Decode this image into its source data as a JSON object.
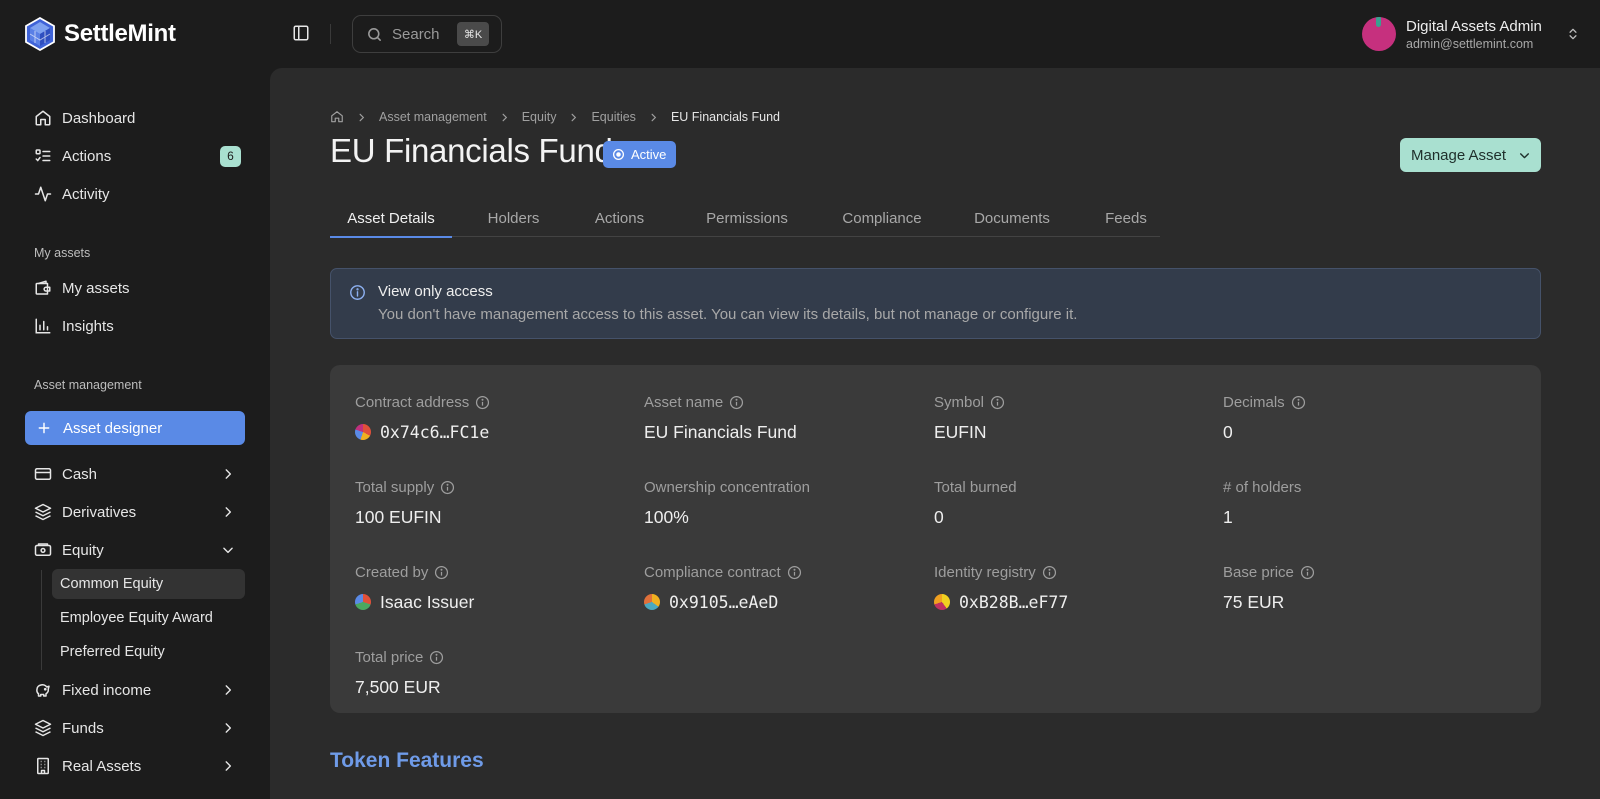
{
  "brand": {
    "name": "SettleMint"
  },
  "topbar": {
    "search_placeholder": "Search",
    "search_shortcut": "⌘K"
  },
  "user": {
    "name": "Digital Assets Admin",
    "email": "admin@settlemint.com"
  },
  "sidebar": {
    "main_items": [
      {
        "label": "Dashboard",
        "icon": "home-icon"
      },
      {
        "label": "Actions",
        "icon": "checklist-icon",
        "badge": "6"
      },
      {
        "label": "Activity",
        "icon": "activity-icon"
      }
    ],
    "my_assets_label": "My assets",
    "my_assets_items": [
      {
        "label": "My assets",
        "icon": "wallet-icon"
      },
      {
        "label": "Insights",
        "icon": "bar-chart-icon"
      }
    ],
    "asset_management_label": "Asset management",
    "asset_designer_label": "Asset designer",
    "asset_items": [
      {
        "label": "Cash",
        "icon": "banknote-icon"
      },
      {
        "label": "Derivatives",
        "icon": "layers-icon"
      },
      {
        "label": "Equity",
        "icon": "equity-icon",
        "expanded": true
      },
      {
        "label": "Fixed income",
        "icon": "piggy-bank-icon"
      },
      {
        "label": "Funds",
        "icon": "layers-icon"
      },
      {
        "label": "Real Assets",
        "icon": "building-icon"
      }
    ],
    "equity_subitems": [
      {
        "label": "Common Equity",
        "active": true
      },
      {
        "label": "Employee Equity Award"
      },
      {
        "label": "Preferred Equity"
      }
    ]
  },
  "breadcrumb": [
    "Asset management",
    "Equity",
    "Equities",
    "EU Financials Fund"
  ],
  "page": {
    "title": "EU Financials Fund",
    "status": "Active",
    "manage_button": "Manage Asset"
  },
  "tabs": [
    "Asset Details",
    "Holders",
    "Actions",
    "Permissions",
    "Compliance",
    "Documents",
    "Feeds"
  ],
  "alert": {
    "title": "View only access",
    "description": "You don't have management access to this asset. You can view its details, but not manage or configure it."
  },
  "details": {
    "contract_address": {
      "label": "Contract address",
      "value": "0x74c6…FC1e"
    },
    "asset_name": {
      "label": "Asset name",
      "value": "EU Financials Fund"
    },
    "symbol": {
      "label": "Symbol",
      "value": "EUFIN"
    },
    "decimals": {
      "label": "Decimals",
      "value": "0"
    },
    "total_supply": {
      "label": "Total supply",
      "value": "100 EUFIN"
    },
    "ownership_concentration": {
      "label": "Ownership concentration",
      "value": "100%"
    },
    "total_burned": {
      "label": "Total burned",
      "value": "0"
    },
    "holders_count": {
      "label": "# of holders",
      "value": "1"
    },
    "created_by": {
      "label": "Created by",
      "value": "Isaac Issuer"
    },
    "compliance_contract": {
      "label": "Compliance contract",
      "value": "0x9105…eAeD"
    },
    "identity_registry": {
      "label": "Identity registry",
      "value": "0xB28B…eF77"
    },
    "base_price": {
      "label": "Base price",
      "value": "75 EUR"
    },
    "total_price": {
      "label": "Total price",
      "value": "7,500 EUR"
    }
  },
  "token_features_title": "Token Features",
  "colors": {
    "accent": "#5a8ae6",
    "mint": "#a9e0d0",
    "background": "#1c1c1c",
    "panel": "#2b2b2b",
    "card": "#3a3a3a"
  }
}
